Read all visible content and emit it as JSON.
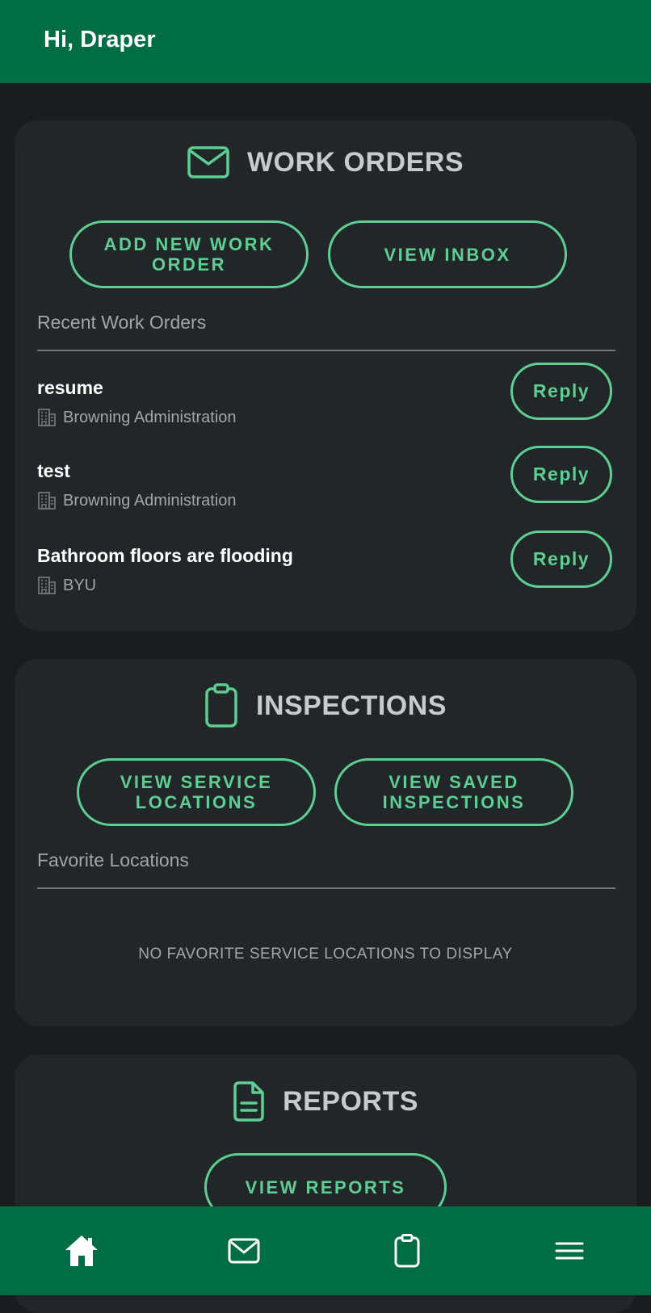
{
  "header": {
    "greeting": "Hi, Draper"
  },
  "work_orders": {
    "title": "WORK ORDERS",
    "add_button": "ADD NEW WORK ORDER",
    "inbox_button": "VIEW INBOX",
    "recent_label": "Recent Work Orders",
    "items": [
      {
        "title": "resume",
        "location": "Browning Administration",
        "action": "Reply"
      },
      {
        "title": "test",
        "location": "Browning Administration",
        "action": "Reply"
      },
      {
        "title": "Bathroom floors are flooding",
        "location": "BYU",
        "action": "Reply"
      }
    ]
  },
  "inspections": {
    "title": "INSPECTIONS",
    "service_button": "VIEW SERVICE LOCATIONS",
    "saved_button": "VIEW SAVED INSPECTIONS",
    "favorites_label": "Favorite Locations",
    "empty_message": "NO FAVORITE SERVICE LOCATIONS TO DISPLAY"
  },
  "reports": {
    "title": "REPORTS",
    "view_button": "VIEW REPORTS"
  },
  "nav": {
    "items": [
      {
        "icon": "home-icon",
        "active": true
      },
      {
        "icon": "mail-icon"
      },
      {
        "icon": "clipboard-icon"
      },
      {
        "icon": "menu-icon"
      }
    ]
  },
  "colors": {
    "header": "#006d44",
    "background": "#1a1d1f",
    "card": "#212629",
    "accent": "#5ece93"
  }
}
